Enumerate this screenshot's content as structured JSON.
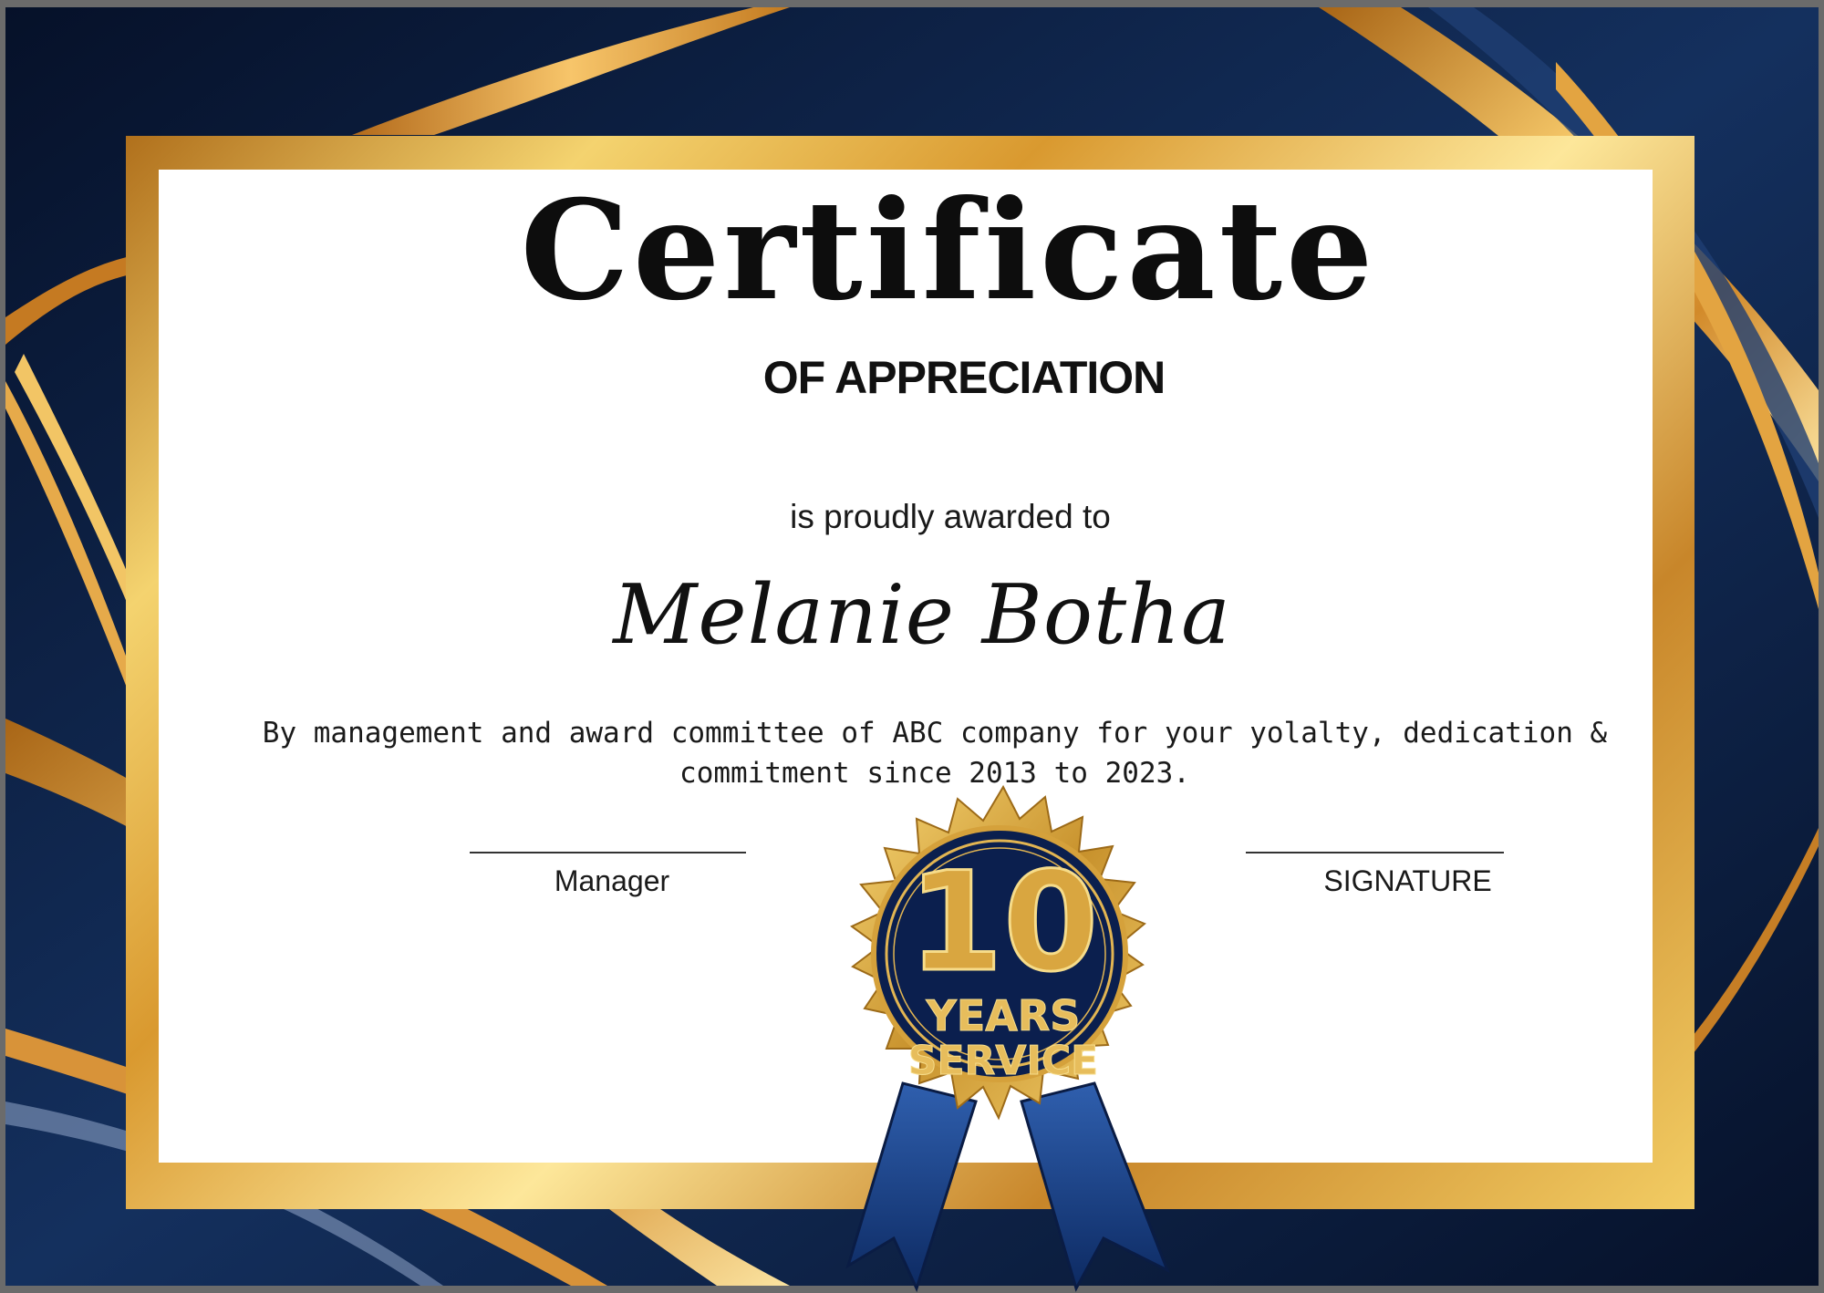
{
  "certificate": {
    "title": "Certificate",
    "subtitle": "OF APPRECIATION",
    "awarded_text": "is proudly awarded to",
    "recipient_name": "Melanie Botha",
    "body_line1": "By management and award committee of ABC company for your yolalty, dedication &",
    "body_line2": "commitment since 2013 to 2023."
  },
  "signatures": {
    "left_line": "__________________",
    "left_label": "Manager",
    "right_line": "_________________",
    "right_label": "SIGNATURE"
  },
  "seal": {
    "number": "10",
    "line1": "YEARS",
    "line2": "SERVICE"
  },
  "colors": {
    "navy": "#0b1a3a",
    "gold": "#e0a83a",
    "paper": "#ffffff"
  }
}
